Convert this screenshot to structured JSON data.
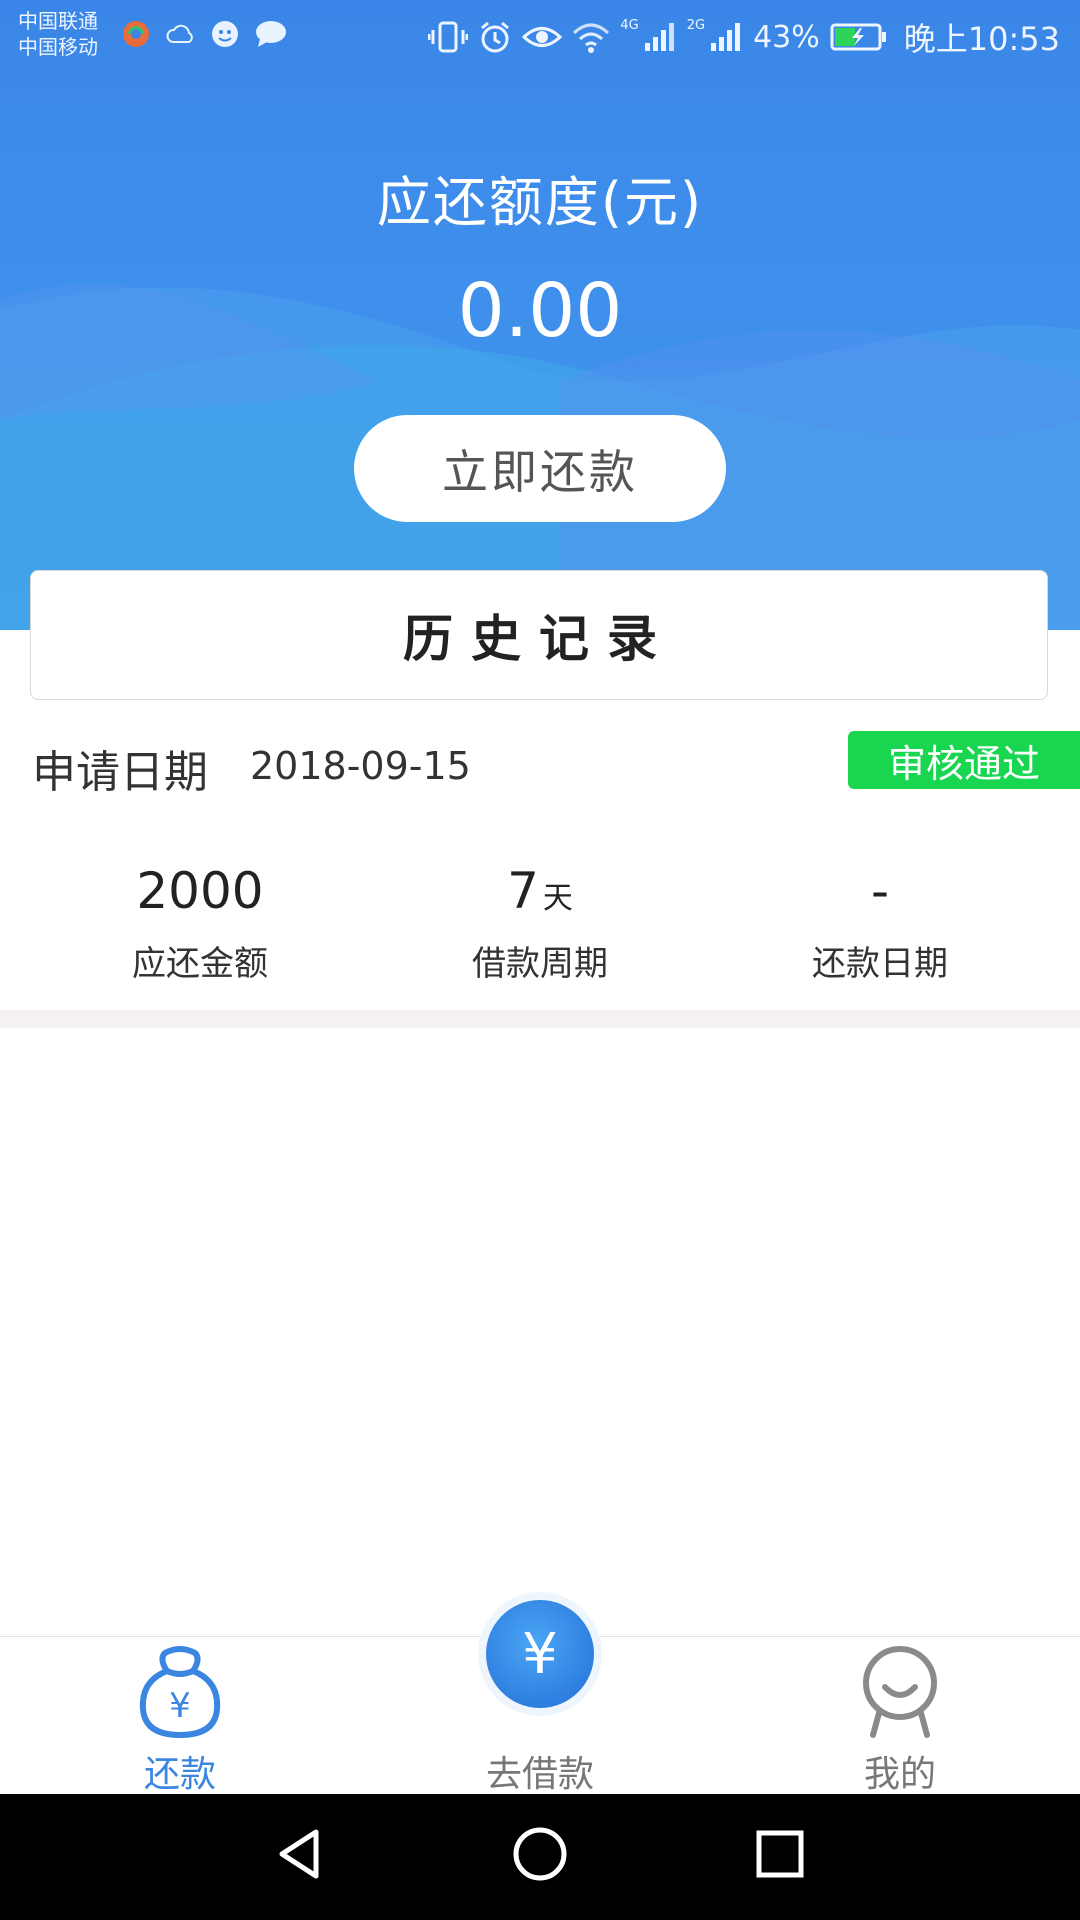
{
  "status_bar": {
    "carrier_1": "中国联通",
    "carrier_2": "中国移动",
    "net_1": "4G",
    "net_2": "2G",
    "battery_percent": "43%",
    "time": "晚上10:53"
  },
  "header": {
    "title": "应还额度(元)",
    "amount": "0.00",
    "repay_now_label": "立即还款"
  },
  "history": {
    "title": "历史记录"
  },
  "record": {
    "apply_date_label": "申请日期",
    "apply_date": "2018-09-15",
    "status": "审核通过",
    "amount_value": "2000",
    "amount_label": "应还金额",
    "period_value": "7",
    "period_unit": "天",
    "period_label": "借款周期",
    "repay_date_value": "-",
    "repay_date_label": "还款日期"
  },
  "tabs": {
    "repay": "还款",
    "borrow": "去借款",
    "mine": "我的",
    "borrow_symbol": "¥",
    "repay_symbol": "¥"
  },
  "colors": {
    "primary_blue": "#3a86e8",
    "status_green": "#18d64f",
    "active_tab": "#3a86e0"
  }
}
